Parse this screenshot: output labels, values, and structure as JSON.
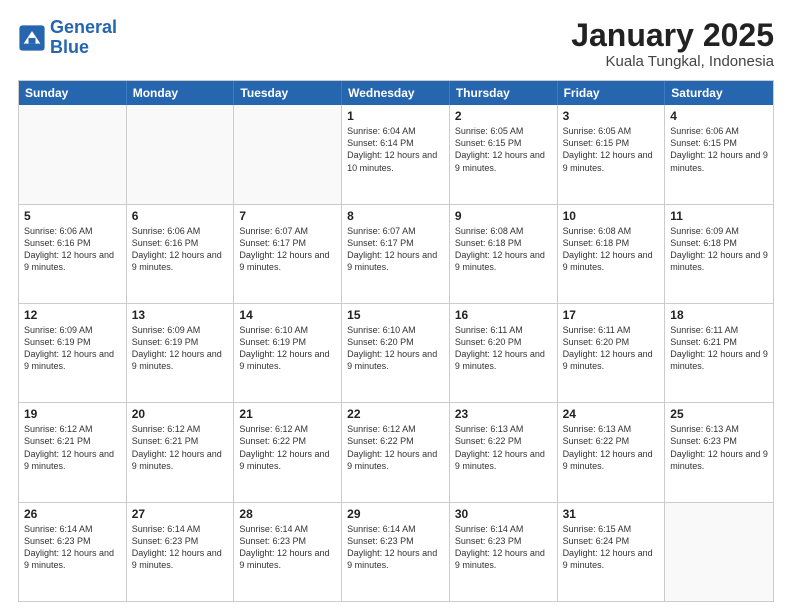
{
  "logo": {
    "line1": "General",
    "line2": "Blue"
  },
  "title": "January 2025",
  "subtitle": "Kuala Tungkal, Indonesia",
  "header": {
    "days": [
      "Sunday",
      "Monday",
      "Tuesday",
      "Wednesday",
      "Thursday",
      "Friday",
      "Saturday"
    ]
  },
  "weeks": [
    [
      {
        "day": "",
        "empty": true
      },
      {
        "day": "",
        "empty": true
      },
      {
        "day": "",
        "empty": true
      },
      {
        "day": "1",
        "sunrise": "6:04 AM",
        "sunset": "6:14 PM",
        "daylight": "12 hours and 10 minutes."
      },
      {
        "day": "2",
        "sunrise": "6:05 AM",
        "sunset": "6:15 PM",
        "daylight": "12 hours and 9 minutes."
      },
      {
        "day": "3",
        "sunrise": "6:05 AM",
        "sunset": "6:15 PM",
        "daylight": "12 hours and 9 minutes."
      },
      {
        "day": "4",
        "sunrise": "6:06 AM",
        "sunset": "6:15 PM",
        "daylight": "12 hours and 9 minutes."
      }
    ],
    [
      {
        "day": "5",
        "sunrise": "6:06 AM",
        "sunset": "6:16 PM",
        "daylight": "12 hours and 9 minutes."
      },
      {
        "day": "6",
        "sunrise": "6:06 AM",
        "sunset": "6:16 PM",
        "daylight": "12 hours and 9 minutes."
      },
      {
        "day": "7",
        "sunrise": "6:07 AM",
        "sunset": "6:17 PM",
        "daylight": "12 hours and 9 minutes."
      },
      {
        "day": "8",
        "sunrise": "6:07 AM",
        "sunset": "6:17 PM",
        "daylight": "12 hours and 9 minutes."
      },
      {
        "day": "9",
        "sunrise": "6:08 AM",
        "sunset": "6:18 PM",
        "daylight": "12 hours and 9 minutes."
      },
      {
        "day": "10",
        "sunrise": "6:08 AM",
        "sunset": "6:18 PM",
        "daylight": "12 hours and 9 minutes."
      },
      {
        "day": "11",
        "sunrise": "6:09 AM",
        "sunset": "6:18 PM",
        "daylight": "12 hours and 9 minutes."
      }
    ],
    [
      {
        "day": "12",
        "sunrise": "6:09 AM",
        "sunset": "6:19 PM",
        "daylight": "12 hours and 9 minutes."
      },
      {
        "day": "13",
        "sunrise": "6:09 AM",
        "sunset": "6:19 PM",
        "daylight": "12 hours and 9 minutes."
      },
      {
        "day": "14",
        "sunrise": "6:10 AM",
        "sunset": "6:19 PM",
        "daylight": "12 hours and 9 minutes."
      },
      {
        "day": "15",
        "sunrise": "6:10 AM",
        "sunset": "6:20 PM",
        "daylight": "12 hours and 9 minutes."
      },
      {
        "day": "16",
        "sunrise": "6:11 AM",
        "sunset": "6:20 PM",
        "daylight": "12 hours and 9 minutes."
      },
      {
        "day": "17",
        "sunrise": "6:11 AM",
        "sunset": "6:20 PM",
        "daylight": "12 hours and 9 minutes."
      },
      {
        "day": "18",
        "sunrise": "6:11 AM",
        "sunset": "6:21 PM",
        "daylight": "12 hours and 9 minutes."
      }
    ],
    [
      {
        "day": "19",
        "sunrise": "6:12 AM",
        "sunset": "6:21 PM",
        "daylight": "12 hours and 9 minutes."
      },
      {
        "day": "20",
        "sunrise": "6:12 AM",
        "sunset": "6:21 PM",
        "daylight": "12 hours and 9 minutes."
      },
      {
        "day": "21",
        "sunrise": "6:12 AM",
        "sunset": "6:22 PM",
        "daylight": "12 hours and 9 minutes."
      },
      {
        "day": "22",
        "sunrise": "6:12 AM",
        "sunset": "6:22 PM",
        "daylight": "12 hours and 9 minutes."
      },
      {
        "day": "23",
        "sunrise": "6:13 AM",
        "sunset": "6:22 PM",
        "daylight": "12 hours and 9 minutes."
      },
      {
        "day": "24",
        "sunrise": "6:13 AM",
        "sunset": "6:22 PM",
        "daylight": "12 hours and 9 minutes."
      },
      {
        "day": "25",
        "sunrise": "6:13 AM",
        "sunset": "6:23 PM",
        "daylight": "12 hours and 9 minutes."
      }
    ],
    [
      {
        "day": "26",
        "sunrise": "6:14 AM",
        "sunset": "6:23 PM",
        "daylight": "12 hours and 9 minutes."
      },
      {
        "day": "27",
        "sunrise": "6:14 AM",
        "sunset": "6:23 PM",
        "daylight": "12 hours and 9 minutes."
      },
      {
        "day": "28",
        "sunrise": "6:14 AM",
        "sunset": "6:23 PM",
        "daylight": "12 hours and 9 minutes."
      },
      {
        "day": "29",
        "sunrise": "6:14 AM",
        "sunset": "6:23 PM",
        "daylight": "12 hours and 9 minutes."
      },
      {
        "day": "30",
        "sunrise": "6:14 AM",
        "sunset": "6:23 PM",
        "daylight": "12 hours and 9 minutes."
      },
      {
        "day": "31",
        "sunrise": "6:15 AM",
        "sunset": "6:24 PM",
        "daylight": "12 hours and 9 minutes."
      },
      {
        "day": "",
        "empty": true
      }
    ]
  ]
}
